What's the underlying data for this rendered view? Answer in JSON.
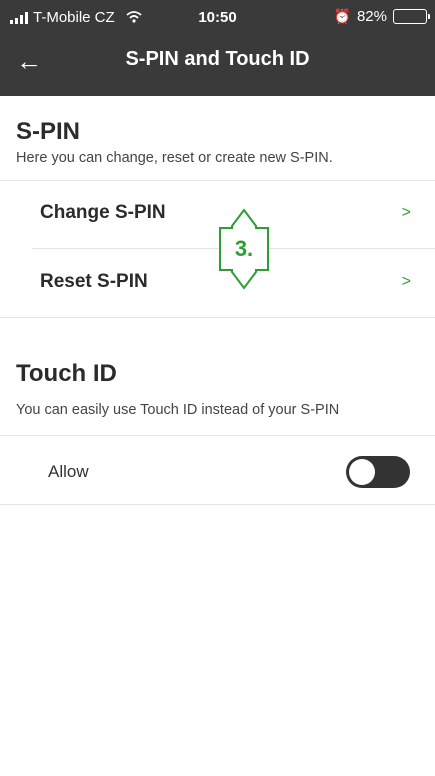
{
  "status_bar": {
    "carrier": "T-Mobile CZ",
    "time": "10:50",
    "battery": "82%",
    "battery_level": 0.82
  },
  "nav": {
    "title": "S-PIN and Touch ID",
    "back_icon": "←"
  },
  "spin_section": {
    "title": "S-PIN",
    "description": "Here you can change, reset or create new S-PIN.",
    "items": [
      {
        "label": "Change S-PIN",
        "chevron": ">"
      },
      {
        "label": "Reset S-PIN",
        "chevron": ">"
      }
    ]
  },
  "touchid_section": {
    "title": "Touch ID",
    "description": "You can easily use Touch ID instead of your S-PIN",
    "toggle": {
      "label": "Allow",
      "enabled": false
    }
  },
  "annotation": {
    "label": "3.",
    "color": "#2e9e34"
  },
  "colors": {
    "header_bg": "#3a3a3a",
    "accent": "#2e9e34"
  }
}
